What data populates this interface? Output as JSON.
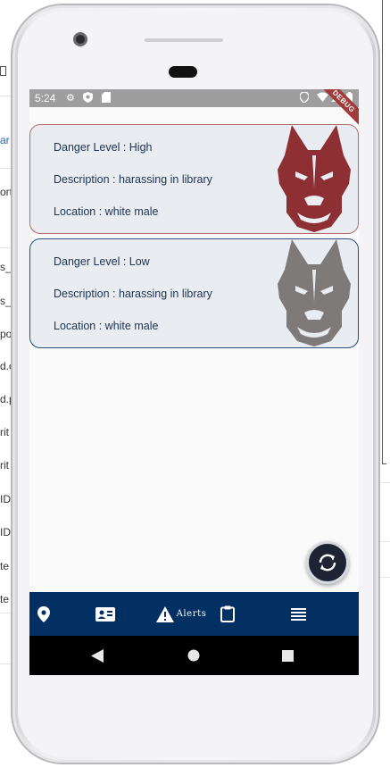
{
  "background": {
    "left_fragments": [
      "",
      "ar",
      "ort",
      "",
      "s_c",
      "s_c",
      "po",
      "d.c",
      "d.p",
      "rit",
      "rit",
      "ID",
      "ID",
      "te",
      "te"
    ]
  },
  "status_bar": {
    "time": "5:24",
    "debug_label": "DEBUG"
  },
  "alerts": [
    {
      "danger_label": "Danger Level : High",
      "description_label": "Description : harassing in library",
      "location_label": "Location : white male",
      "color": "#8e2f33"
    },
    {
      "danger_label": "Danger Level : Low",
      "description_label": "Description : harassing in library",
      "location_label": "Location : white male",
      "color": "#7f7a7a"
    }
  ],
  "bottom_nav": {
    "alerts_label": "Alerts",
    "items": [
      "location-icon",
      "contact-card-icon",
      "warning-icon",
      "clipboard-icon",
      "menu-icon"
    ]
  },
  "colors": {
    "nav_background": "#033063",
    "high_accent": "#8e2f33",
    "low_accent": "#294d78"
  }
}
